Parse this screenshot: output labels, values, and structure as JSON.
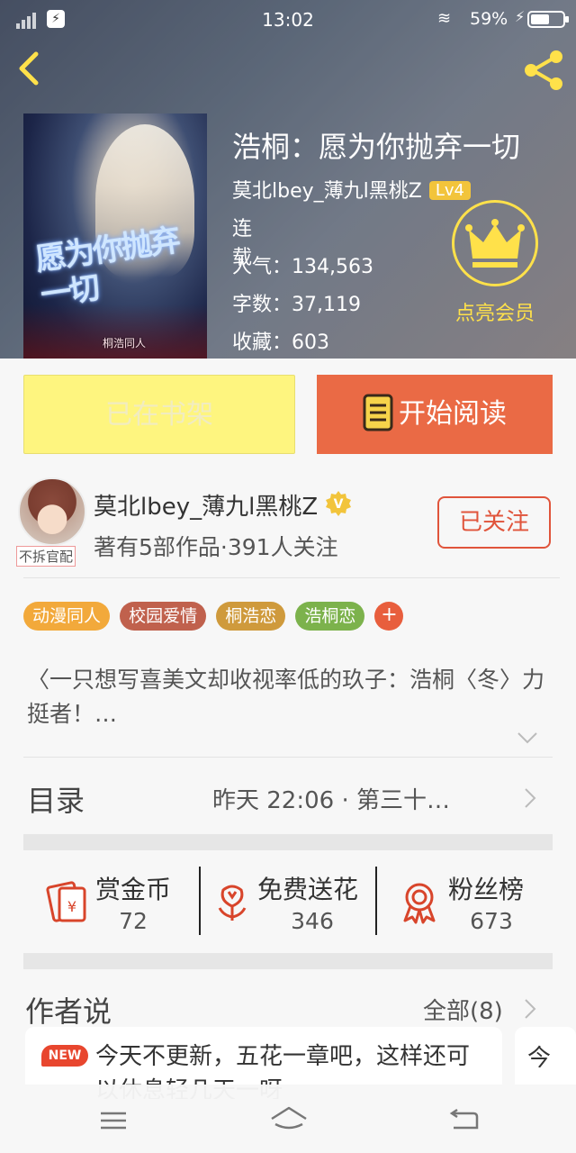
{
  "status_bar": {
    "time": "13:02",
    "battery_percent": "59%",
    "charging_symbol": "⚡",
    "wifi_symbol": "≋",
    "app_glyph": "⚡"
  },
  "header": {
    "back_icon": "chevron-left-icon",
    "share_icon": "share-icon"
  },
  "book": {
    "title": "浩桐：愿为你抛弃一切",
    "author": "莫北lbey_薄九l黑桃Z",
    "level": "Lv4",
    "status": "连载",
    "popularity": "人气：134,563",
    "word_count": "字数：37,119",
    "favorites": "收藏：603",
    "cover_calligraphy": "愿为你抛弃一切",
    "cover_tag": "桐浩同人"
  },
  "vip": {
    "label": "点亮会员",
    "icon": "crown-icon"
  },
  "actions": {
    "shelf_label": "已在书架",
    "read_label": "开始阅读"
  },
  "author": {
    "name": "莫北lbey_薄九l黑桃Z",
    "verified_badge": "V",
    "avatar_badge": "不拆官配",
    "meta": "著有5部作品·391人关注",
    "follow_label": "已关注"
  },
  "tags": [
    {
      "label": "动漫同人",
      "color": "#f2a93b"
    },
    {
      "label": "校园爱情",
      "color": "#c0614d"
    },
    {
      "label": "桐浩恋",
      "color": "#cf9a3c"
    },
    {
      "label": "浩桐恋",
      "color": "#7cb24c"
    }
  ],
  "tag_add": "+",
  "intro": "〈一只想写喜美文却收视率低的玖子：浩桐〈冬〉力挺者！…",
  "catalog": {
    "title": "目录",
    "update": "昨天 22:06 · 第三十…"
  },
  "stats": [
    {
      "label": "赏金币",
      "value": "72",
      "icon": "coin-envelope-icon"
    },
    {
      "label": "免费送花",
      "value": "346",
      "icon": "flower-icon"
    },
    {
      "label": "粉丝榜",
      "value": "673",
      "icon": "medal-icon"
    }
  ],
  "author_says": {
    "title": "作者说",
    "all_label": "全部(8)",
    "new_badge": "NEW",
    "post_text": "今天不更新，五花一章吧，这样还可以休息轻几天一呀",
    "second_text": "今"
  },
  "colors": {
    "accent_orange": "#ea6a45",
    "shelf_yellow": "#fef57f",
    "vip_gold": "#ffe14a",
    "follow_red": "#e0543b"
  }
}
